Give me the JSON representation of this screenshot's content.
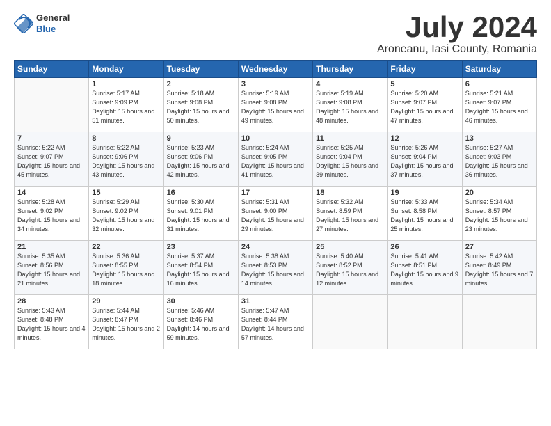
{
  "header": {
    "logo_general": "General",
    "logo_blue": "Blue",
    "month_title": "July 2024",
    "subtitle": "Aroneanu, Iasi County, Romania"
  },
  "weekdays": [
    "Sunday",
    "Monday",
    "Tuesday",
    "Wednesday",
    "Thursday",
    "Friday",
    "Saturday"
  ],
  "weeks": [
    [
      {
        "day": "",
        "info": ""
      },
      {
        "day": "1",
        "info": "Sunrise: 5:17 AM\nSunset: 9:09 PM\nDaylight: 15 hours\nand 51 minutes."
      },
      {
        "day": "2",
        "info": "Sunrise: 5:18 AM\nSunset: 9:08 PM\nDaylight: 15 hours\nand 50 minutes."
      },
      {
        "day": "3",
        "info": "Sunrise: 5:19 AM\nSunset: 9:08 PM\nDaylight: 15 hours\nand 49 minutes."
      },
      {
        "day": "4",
        "info": "Sunrise: 5:19 AM\nSunset: 9:08 PM\nDaylight: 15 hours\nand 48 minutes."
      },
      {
        "day": "5",
        "info": "Sunrise: 5:20 AM\nSunset: 9:07 PM\nDaylight: 15 hours\nand 47 minutes."
      },
      {
        "day": "6",
        "info": "Sunrise: 5:21 AM\nSunset: 9:07 PM\nDaylight: 15 hours\nand 46 minutes."
      }
    ],
    [
      {
        "day": "7",
        "info": "Sunrise: 5:22 AM\nSunset: 9:07 PM\nDaylight: 15 hours\nand 45 minutes."
      },
      {
        "day": "8",
        "info": "Sunrise: 5:22 AM\nSunset: 9:06 PM\nDaylight: 15 hours\nand 43 minutes."
      },
      {
        "day": "9",
        "info": "Sunrise: 5:23 AM\nSunset: 9:06 PM\nDaylight: 15 hours\nand 42 minutes."
      },
      {
        "day": "10",
        "info": "Sunrise: 5:24 AM\nSunset: 9:05 PM\nDaylight: 15 hours\nand 41 minutes."
      },
      {
        "day": "11",
        "info": "Sunrise: 5:25 AM\nSunset: 9:04 PM\nDaylight: 15 hours\nand 39 minutes."
      },
      {
        "day": "12",
        "info": "Sunrise: 5:26 AM\nSunset: 9:04 PM\nDaylight: 15 hours\nand 37 minutes."
      },
      {
        "day": "13",
        "info": "Sunrise: 5:27 AM\nSunset: 9:03 PM\nDaylight: 15 hours\nand 36 minutes."
      }
    ],
    [
      {
        "day": "14",
        "info": "Sunrise: 5:28 AM\nSunset: 9:02 PM\nDaylight: 15 hours\nand 34 minutes."
      },
      {
        "day": "15",
        "info": "Sunrise: 5:29 AM\nSunset: 9:02 PM\nDaylight: 15 hours\nand 32 minutes."
      },
      {
        "day": "16",
        "info": "Sunrise: 5:30 AM\nSunset: 9:01 PM\nDaylight: 15 hours\nand 31 minutes."
      },
      {
        "day": "17",
        "info": "Sunrise: 5:31 AM\nSunset: 9:00 PM\nDaylight: 15 hours\nand 29 minutes."
      },
      {
        "day": "18",
        "info": "Sunrise: 5:32 AM\nSunset: 8:59 PM\nDaylight: 15 hours\nand 27 minutes."
      },
      {
        "day": "19",
        "info": "Sunrise: 5:33 AM\nSunset: 8:58 PM\nDaylight: 15 hours\nand 25 minutes."
      },
      {
        "day": "20",
        "info": "Sunrise: 5:34 AM\nSunset: 8:57 PM\nDaylight: 15 hours\nand 23 minutes."
      }
    ],
    [
      {
        "day": "21",
        "info": "Sunrise: 5:35 AM\nSunset: 8:56 PM\nDaylight: 15 hours\nand 21 minutes."
      },
      {
        "day": "22",
        "info": "Sunrise: 5:36 AM\nSunset: 8:55 PM\nDaylight: 15 hours\nand 18 minutes."
      },
      {
        "day": "23",
        "info": "Sunrise: 5:37 AM\nSunset: 8:54 PM\nDaylight: 15 hours\nand 16 minutes."
      },
      {
        "day": "24",
        "info": "Sunrise: 5:38 AM\nSunset: 8:53 PM\nDaylight: 15 hours\nand 14 minutes."
      },
      {
        "day": "25",
        "info": "Sunrise: 5:40 AM\nSunset: 8:52 PM\nDaylight: 15 hours\nand 12 minutes."
      },
      {
        "day": "26",
        "info": "Sunrise: 5:41 AM\nSunset: 8:51 PM\nDaylight: 15 hours\nand 9 minutes."
      },
      {
        "day": "27",
        "info": "Sunrise: 5:42 AM\nSunset: 8:49 PM\nDaylight: 15 hours\nand 7 minutes."
      }
    ],
    [
      {
        "day": "28",
        "info": "Sunrise: 5:43 AM\nSunset: 8:48 PM\nDaylight: 15 hours\nand 4 minutes."
      },
      {
        "day": "29",
        "info": "Sunrise: 5:44 AM\nSunset: 8:47 PM\nDaylight: 15 hours\nand 2 minutes."
      },
      {
        "day": "30",
        "info": "Sunrise: 5:46 AM\nSunset: 8:46 PM\nDaylight: 14 hours\nand 59 minutes."
      },
      {
        "day": "31",
        "info": "Sunrise: 5:47 AM\nSunset: 8:44 PM\nDaylight: 14 hours\nand 57 minutes."
      },
      {
        "day": "",
        "info": ""
      },
      {
        "day": "",
        "info": ""
      },
      {
        "day": "",
        "info": ""
      }
    ]
  ]
}
